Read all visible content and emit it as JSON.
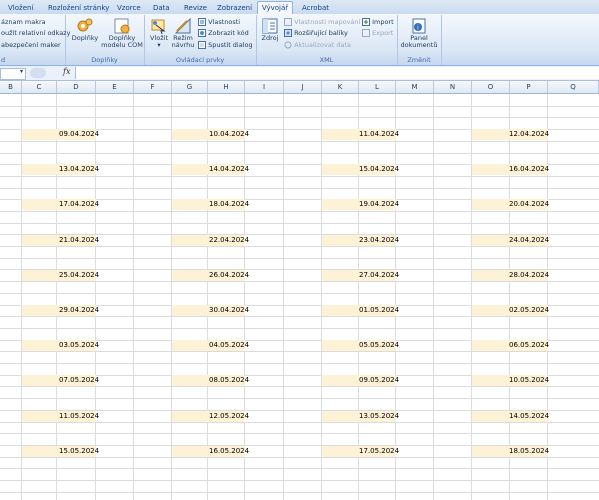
{
  "ribbon_tabs": [
    "Vložení",
    "Rozložení stránky",
    "Vzorce",
    "Data",
    "Revize",
    "Zobrazení",
    "Vývojář",
    "Acrobat"
  ],
  "active_tab": "Vývojář",
  "code_group": {
    "items": [
      "áznam makra",
      "oužít relativní odkazy",
      "abezpečení maker"
    ],
    "label": "d"
  },
  "addins_group": {
    "addins_label": "Doplňky",
    "com_label_1": "Doplňky",
    "com_label_2": "modelu COM",
    "label": "Doplňky"
  },
  "controls_group": {
    "insert_label": "Vložit",
    "design_label_1": "Režim",
    "design_label_2": "návrhu",
    "properties": "Vlastnosti",
    "view_code": "Zobrazit kód",
    "run_dialog": "Spustit dialog",
    "label": "Ovládací prvky"
  },
  "xml_group": {
    "source_label": "Zdroj",
    "map_properties": "Vlastnosti mapování",
    "expansion_packs": "Rozšiřující balíky",
    "refresh_data": "Aktualizovat data",
    "import": "Import",
    "export": "Export",
    "label": "XML"
  },
  "modify_group": {
    "panel_label_1": "Panel",
    "panel_label_2": "dokumentů",
    "label": "Změnit"
  },
  "formula_bar": {
    "fx": "fx"
  },
  "columns": [
    "B",
    "C",
    "D",
    "E",
    "F",
    "G",
    "H",
    "I",
    "J",
    "K",
    "L",
    "M",
    "N",
    "O",
    "P",
    "Q"
  ],
  "date_rows": [
    [
      "09.04.2024",
      "10.04.2024",
      "11.04.2024",
      "12.04.2024"
    ],
    [
      "13.04.2024",
      "14.04.2024",
      "15.04.2024",
      "16.04.2024"
    ],
    [
      "17.04.2024",
      "18.04.2024",
      "19.04.2024",
      "20.04.2024"
    ],
    [
      "21.04.2024",
      "22.04.2024",
      "23.04.2024",
      "24.04.2024"
    ],
    [
      "25.04.2024",
      "26.04.2024",
      "27.04.2024",
      "28.04.2024"
    ],
    [
      "29.04.2024",
      "30.04.2024",
      "01.05.2024",
      "02.05.2024"
    ],
    [
      "03.05.2024",
      "04.05.2024",
      "05.05.2024",
      "06.05.2024"
    ],
    [
      "07.05.2024",
      "08.05.2024",
      "09.05.2024",
      "10.05.2024"
    ],
    [
      "11.05.2024",
      "12.05.2024",
      "13.05.2024",
      "14.05.2024"
    ],
    [
      "15.05.2024",
      "16.05.2024",
      "17.05.2024",
      "18.05.2024"
    ]
  ],
  "colors": {
    "highlight": "#fdf1d6",
    "ribbon_text": "#15428b",
    "grid_line": "#dadcdd"
  }
}
